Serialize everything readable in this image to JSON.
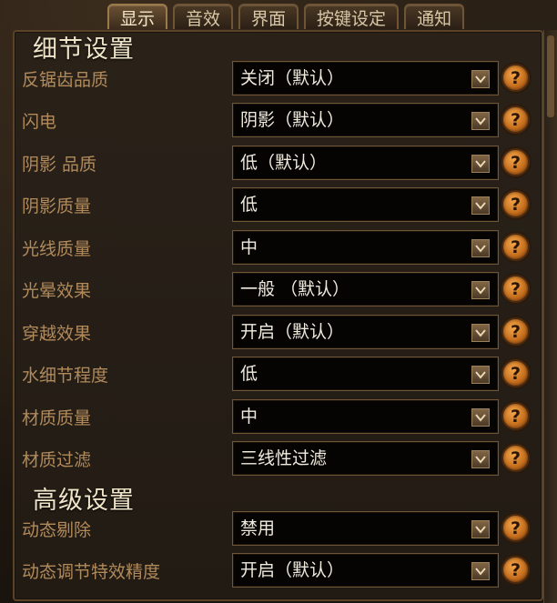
{
  "tabs": [
    {
      "label": "显示",
      "active": true
    },
    {
      "label": "音效",
      "active": false
    },
    {
      "label": "界面",
      "active": false
    },
    {
      "label": "按键设定",
      "active": false
    },
    {
      "label": "通知",
      "active": false
    }
  ],
  "sections": {
    "detail": {
      "title": "细节设置"
    },
    "advanced": {
      "title": "高级设置"
    }
  },
  "settings": [
    {
      "label": "反锯齿品质",
      "value": "关闭（默认）"
    },
    {
      "label": "闪电",
      "value": "阴影（默认）"
    },
    {
      "label": "阴影 品质",
      "value": "低（默认）"
    },
    {
      "label": "阴影质量",
      "value": "低"
    },
    {
      "label": "光线质量",
      "value": "中"
    },
    {
      "label": "光晕效果",
      "value": "一般 （默认）"
    },
    {
      "label": "穿越效果",
      "value": "开启（默认）"
    },
    {
      "label": "水细节程度",
      "value": "低"
    },
    {
      "label": "材质质量",
      "value": "中"
    },
    {
      "label": "材质过滤",
      "value": "三线性过滤"
    },
    {
      "label": "动态剔除",
      "value": "禁用"
    },
    {
      "label": "动态调节特效精度",
      "value": "开启（默认）"
    }
  ],
  "help_glyph": "?",
  "icons": {
    "dropdown": "chevron-down-icon",
    "help": "help-icon"
  },
  "colors": {
    "label": "#b18a5b",
    "value": "#f1ebdf",
    "help_orange": "#c8701e"
  }
}
